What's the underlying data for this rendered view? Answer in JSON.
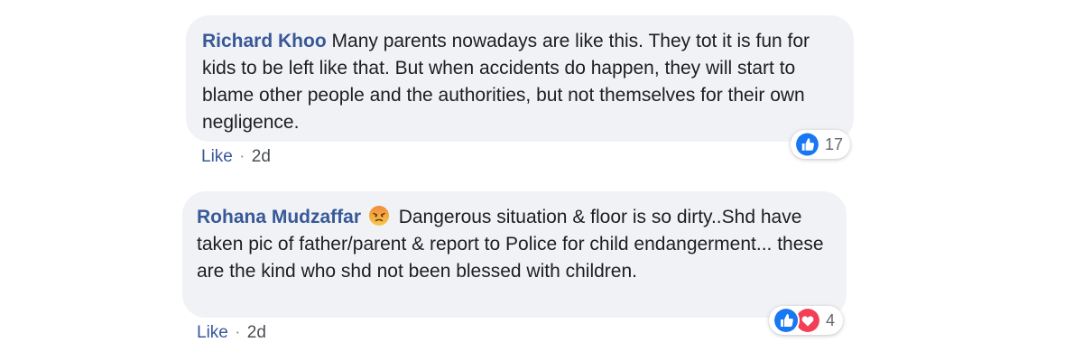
{
  "comments": [
    {
      "author": "Richard Khoo",
      "text": "Many parents nowadays are like this. They tot it is fun for kids to be left like that. But when accidents do happen, they will start to blame other people and the authorities, but not themselves for their own negligence.",
      "like_label": "Like",
      "separator": "·",
      "time": "2d",
      "reaction_count": "17",
      "reactions": [
        "like-icon"
      ]
    },
    {
      "author": "Rohana Mudzaffar",
      "emoji": "angry-face-icon",
      "text": "Dangerous situation & floor is so dirty..Shd have taken pic of father/parent & report to Police for child endangerment... these are the kind who shd not been blessed with children.",
      "like_label": "Like",
      "separator": "·",
      "time": "2d",
      "reaction_count": "4",
      "reactions": [
        "like-icon",
        "love-icon"
      ]
    }
  ],
  "colors": {
    "author": "#385898",
    "bubble": "#f0f2f5",
    "like_blue": "#1877f2",
    "love_red": "#f33e58",
    "angry_orange": "#f5a623"
  }
}
